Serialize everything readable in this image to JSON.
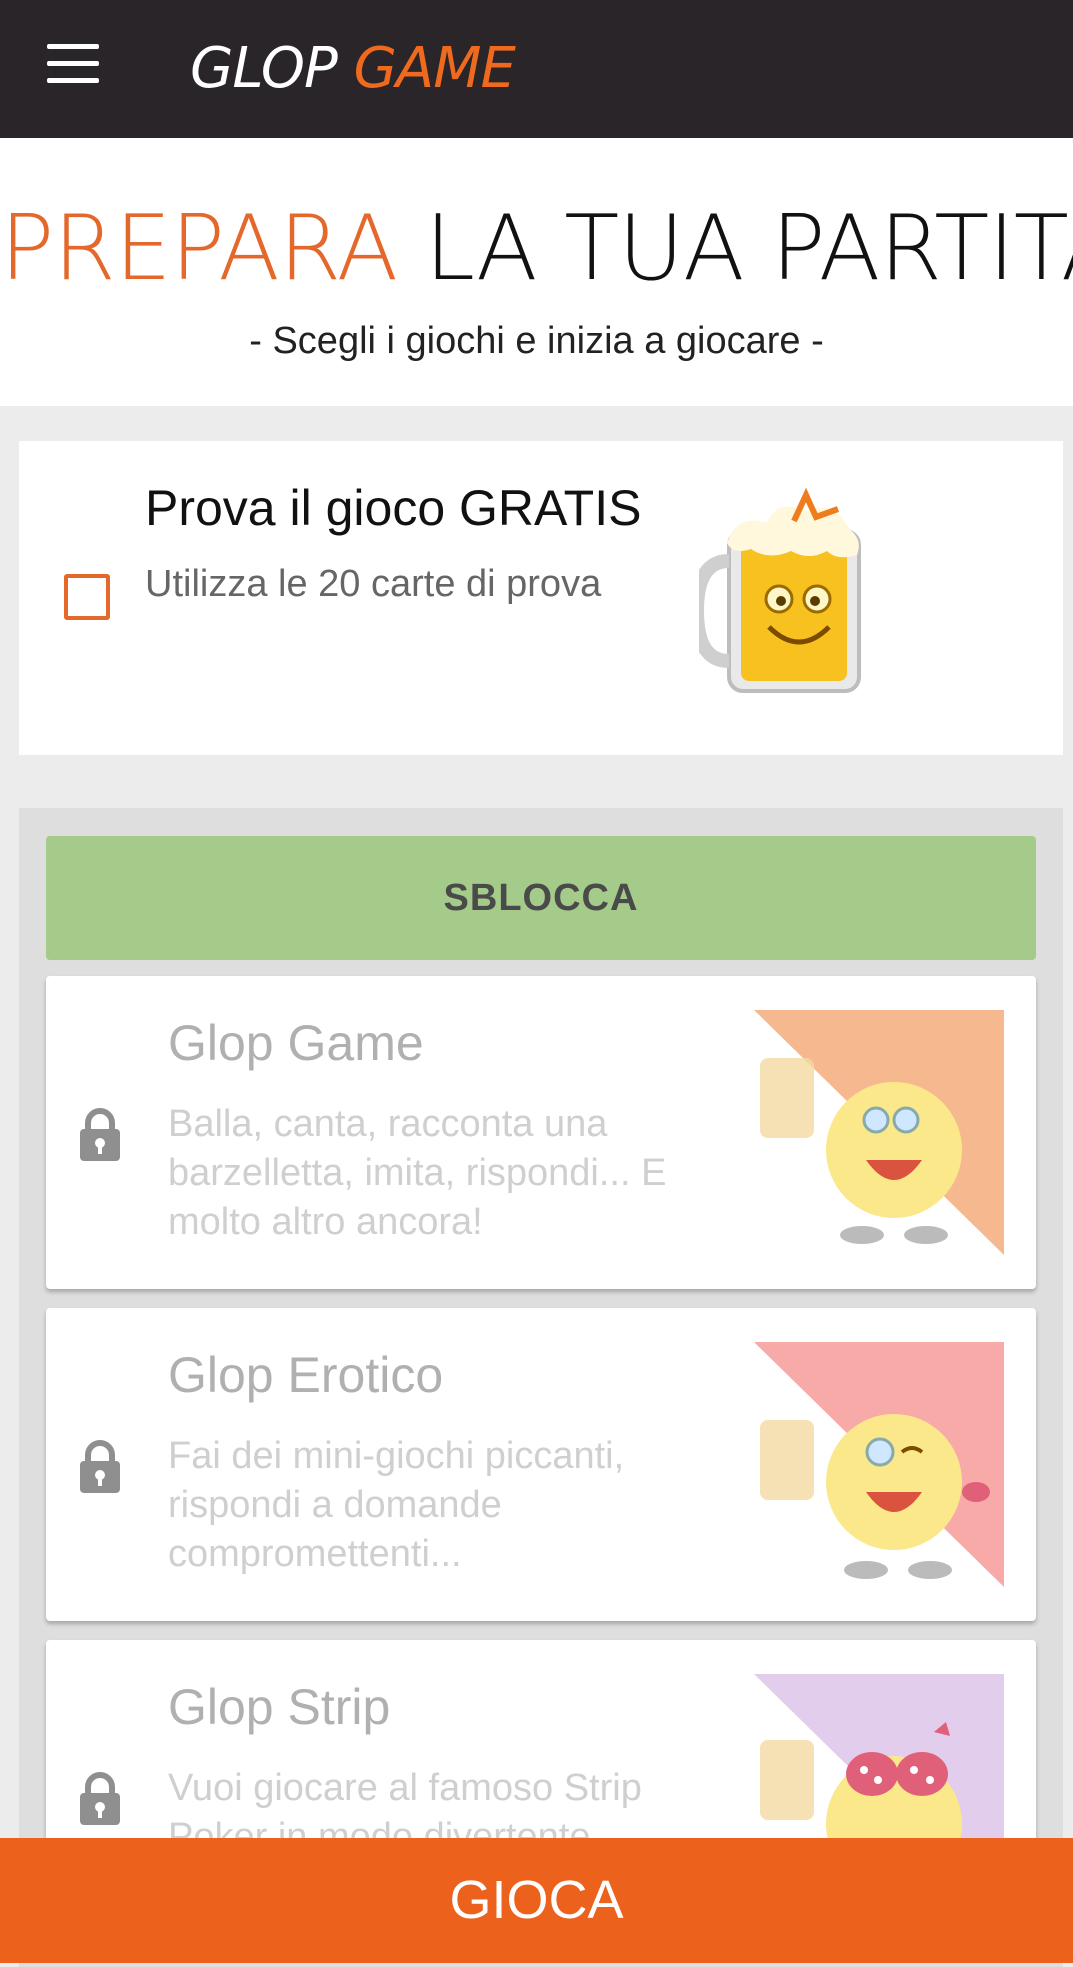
{
  "appbar": {
    "logo_word1": "GLOP",
    "logo_word2": "GAME"
  },
  "heading": {
    "title_accent": "PREPARA",
    "title_rest": "LA TUA PARTITA",
    "subtitle": "- Scegli i giochi e inizia a giocare -"
  },
  "trial": {
    "title": "Prova il gioco GRATIS",
    "subtitle": "Utilizza le 20 carte di prova",
    "checked": false
  },
  "unlock_label": "SBLOCCA",
  "games": [
    {
      "name": "Glop Game",
      "description": "Balla, canta, racconta una barzelletta, imita, rispondi... E molto altro ancora!",
      "color": "#f6b98f",
      "icon": "lock-icon"
    },
    {
      "name": "Glop Erotico",
      "description": "Fai dei mini-giochi piccanti, rispondi a domande compromettenti...",
      "color": "#f7aaa8",
      "icon": "lock-icon"
    },
    {
      "name": "Glop Strip",
      "description": "Vuoi giocare al famoso Strip Poker in modo divertente...",
      "color": "#e3cdec",
      "icon": "lock-icon"
    }
  ],
  "play_label": "GIOCA",
  "colors": {
    "accent": "#e4682c",
    "appbar": "#2a2529",
    "unlock": "#a5cb8a",
    "play": "#ec621c"
  }
}
